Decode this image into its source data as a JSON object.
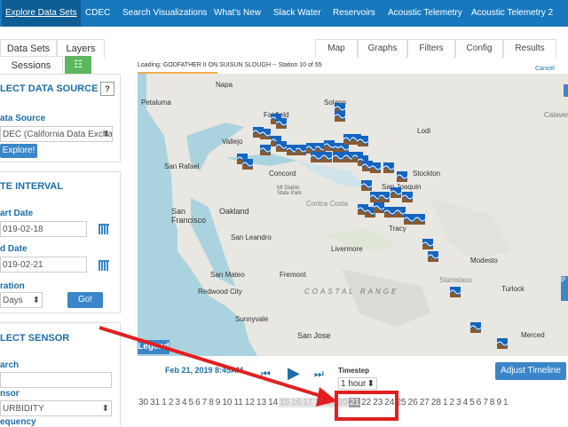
{
  "nav": {
    "tabs": [
      "Explore Data Sets",
      "CDEC",
      "Search Visualizations",
      "What's New",
      "Slack Water",
      "Reservoirs",
      "Acoustic Telemetry",
      "Acoustic Telemetry 2"
    ]
  },
  "sidebar": {
    "tabs": {
      "datasets": "Data Sets",
      "layers": "Layers",
      "sessions": "Sessions"
    },
    "select_source": {
      "title": "LECT DATA SOURCE",
      "help": "?",
      "source_label": "ata Source",
      "source_value": "DEC (California Data Exchange",
      "explore_button": "Explore!"
    },
    "date_interval": {
      "title": "TE INTERVAL",
      "start_label": "art Date",
      "start_value": "019-02-18",
      "end_label": "d Date",
      "end_value": "019-02-21",
      "duration_label": "ration",
      "duration_value": "Days",
      "go_button": "Go!"
    },
    "sensor": {
      "title": "LECT SENSOR",
      "search_label": "arch",
      "search_value": "",
      "sensor_label": "nsor",
      "sensor_value": "URBIDITY",
      "frequency_label": "equency"
    }
  },
  "right_tabs": [
    "Map",
    "Graphs",
    "Filters",
    "Config",
    "Results"
  ],
  "loading": {
    "text": "Loading: GODFATHER II ON SUISUN SLOUGH -- Station 10 of 55",
    "cancel": "Cancel"
  },
  "map": {
    "places": [
      {
        "name": "Napa"
      },
      {
        "name": "Petaluma"
      },
      {
        "name": "Fairfield"
      },
      {
        "name": "Solano"
      },
      {
        "name": "Vallejo"
      },
      {
        "name": "Lodi"
      },
      {
        "name": "San Rafael"
      },
      {
        "name": "Concord"
      },
      {
        "name": "Stockton"
      },
      {
        "name": "San Joaquin"
      },
      {
        "name": "Mt Diablo State Park"
      },
      {
        "name": "Contra Costa"
      },
      {
        "name": "San Francisco"
      },
      {
        "name": "Oakland"
      },
      {
        "name": "Tracy"
      },
      {
        "name": "San Leandro"
      },
      {
        "name": "Livermore"
      },
      {
        "name": "Modesto"
      },
      {
        "name": "San Mateo"
      },
      {
        "name": "Fremont"
      },
      {
        "name": "Stanislaus"
      },
      {
        "name": "Redwood City"
      },
      {
        "name": "COASTAL RANGE"
      },
      {
        "name": "Turlock"
      },
      {
        "name": "Sunnyvale"
      },
      {
        "name": "San Jose"
      },
      {
        "name": "Merced"
      },
      {
        "name": "Calaver"
      },
      {
        "name": "Lodi"
      }
    ],
    "legend": "Legend"
  },
  "timebar": {
    "date": "Feb 21, 2019 8:45AM",
    "timestep_label": "Timestep",
    "timestep_value": "1 hour",
    "adjust_button": "Adjust Timeline"
  },
  "timeline": {
    "days": [
      "30",
      "31",
      "1",
      "2",
      "3",
      "4",
      "5",
      "6",
      "7",
      "8",
      "9",
      "10",
      "11",
      "12",
      "13",
      "14",
      "15",
      "16",
      "17",
      "18",
      "19",
      "20",
      "21",
      "22",
      "23",
      "24",
      "25",
      "26",
      "27",
      "28",
      "1",
      "2",
      "3",
      "4",
      "5",
      "6",
      "7",
      "8",
      "9",
      "1"
    ]
  },
  "colors": {
    "nav": "#1778be",
    "accent": "#1b6ea8",
    "highlight_box": "#e02020",
    "arrow": "#e02020"
  }
}
